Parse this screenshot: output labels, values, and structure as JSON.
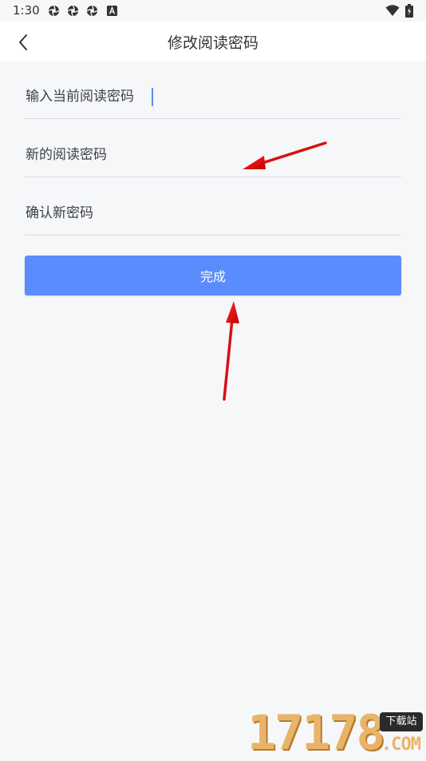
{
  "status_bar": {
    "time": "1:30",
    "icons": [
      "aperture-icon",
      "aperture-icon",
      "aperture-icon",
      "text-a-icon",
      "wifi-icon",
      "battery-icon"
    ]
  },
  "header": {
    "title": "修改阅读密码",
    "back_icon": "chevron-left-icon"
  },
  "form": {
    "current_password_placeholder": "输入当前阅读密码",
    "new_password_placeholder": "新的阅读密码",
    "confirm_password_placeholder": "确认新密码",
    "submit_label": "完成"
  },
  "colors": {
    "accent": "#5b8cfd",
    "background": "#f6f7f9",
    "annotation_arrow": "#e01010"
  },
  "watermark": {
    "digits": "17178",
    "badge": "下载站",
    "domain": ".COM"
  }
}
